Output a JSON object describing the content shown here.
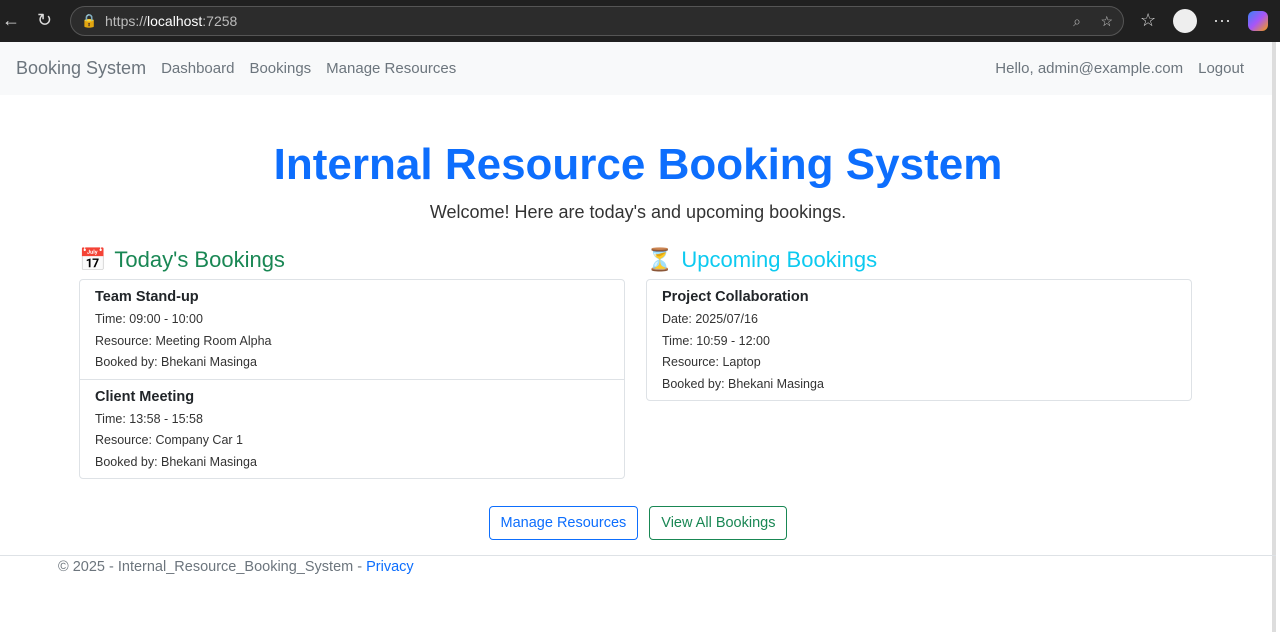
{
  "browser": {
    "url_prefix": "https://",
    "url_host": "localhost",
    "url_port": ":7258"
  },
  "nav": {
    "brand": "Booking System",
    "links": [
      "Dashboard",
      "Bookings",
      "Manage Resources"
    ],
    "greeting": "Hello, admin@example.com",
    "logout": "Logout"
  },
  "hero": {
    "title": "Internal Resource Booking System",
    "subtitle": "Welcome! Here are today's and upcoming bookings."
  },
  "today": {
    "icon": "calendar-icon",
    "heading": "Today's Bookings",
    "items": [
      {
        "title": "Team Stand-up",
        "time": "Time: 09:00 - 10:00",
        "resource": "Resource: Meeting Room Alpha",
        "booked_by": "Booked by: Bhekani Masinga"
      },
      {
        "title": "Client Meeting",
        "time": "Time: 13:58 - 15:58",
        "resource": "Resource: Company Car 1",
        "booked_by": "Booked by: Bhekani Masinga"
      }
    ]
  },
  "upcoming": {
    "icon": "hourglass-icon",
    "heading": "Upcoming Bookings",
    "items": [
      {
        "title": "Project Collaboration",
        "date": "Date: 2025/07/16",
        "time": "Time: 10:59 - 12:00",
        "resource": "Resource: Laptop",
        "booked_by": "Booked by: Bhekani Masinga"
      }
    ]
  },
  "actions": {
    "manage": "Manage Resources",
    "view_all": "View All Bookings"
  },
  "footer": {
    "text": "© 2025 - Internal_Resource_Booking_System - ",
    "privacy": "Privacy"
  },
  "colors": {
    "primary": "#0d6efd",
    "success": "#198754",
    "info": "#0dcaf0"
  }
}
